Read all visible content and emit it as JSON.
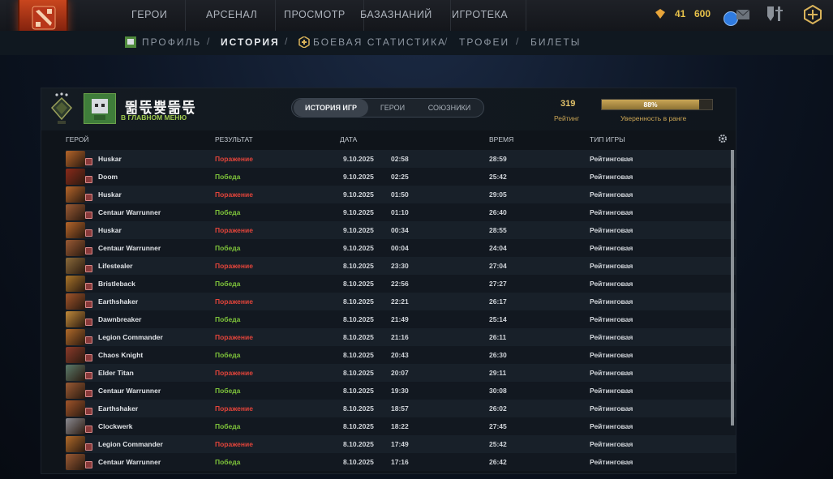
{
  "nav": {
    "items": [
      "ГЕРОИ",
      "АРСЕНАЛ",
      "ПРОСМОТР",
      "БАЗАЗНАНИЙ",
      "ИГРОТЕКА"
    ],
    "coins_a": "41",
    "coins_b": "600"
  },
  "subnav": {
    "items": [
      "ПРОФИЛЬ",
      "ИСТОРИЯ",
      "БОЕВАЯ СТАТИСТИКА",
      "ТРОФЕИ",
      "БИЛЕТЫ"
    ],
    "active": "ИСТОРИЯ",
    "separator": "/"
  },
  "player": {
    "name": "뛺뜫쁒뜲뜫",
    "status": "В ГЛАВНОМ МЕНЮ"
  },
  "tabs": [
    "ИСТОРИЯ ИГР",
    "ГЕРОИ",
    "СОЮЗНИКИ"
  ],
  "rating": {
    "value": "319",
    "label": "Рейтинг",
    "confidence": "88%",
    "confidence_fraction": 0.88,
    "confidence_label": "Уверенность в ранге"
  },
  "columns": [
    "ГЕРОЙ",
    "РЕЗУЛЬТАТ",
    "ДАТА",
    "ВРЕМЯ",
    "ТИП ИГРЫ"
  ],
  "colors": {
    "loss": "#e2443a",
    "win": "#7ec33a",
    "gold": "#e3c36a"
  },
  "matches": [
    {
      "hero": "Huskar",
      "result": "Поражение",
      "outcome": "loss",
      "date": "9.10.2025",
      "time": "02:58",
      "duration": "28:59",
      "type": "Рейтинговая"
    },
    {
      "hero": "Doom",
      "result": "Победа",
      "outcome": "win",
      "date": "9.10.2025",
      "time": "02:25",
      "duration": "25:42",
      "type": "Рейтинговая"
    },
    {
      "hero": "Huskar",
      "result": "Поражение",
      "outcome": "loss",
      "date": "9.10.2025",
      "time": "01:50",
      "duration": "29:05",
      "type": "Рейтинговая"
    },
    {
      "hero": "Centaur Warrunner",
      "result": "Победа",
      "outcome": "win",
      "date": "9.10.2025",
      "time": "01:10",
      "duration": "26:40",
      "type": "Рейтинговая"
    },
    {
      "hero": "Huskar",
      "result": "Поражение",
      "outcome": "loss",
      "date": "9.10.2025",
      "time": "00:34",
      "duration": "28:55",
      "type": "Рейтинговая"
    },
    {
      "hero": "Centaur Warrunner",
      "result": "Победа",
      "outcome": "win",
      "date": "9.10.2025",
      "time": "00:04",
      "duration": "24:04",
      "type": "Рейтинговая"
    },
    {
      "hero": "Lifestealer",
      "result": "Поражение",
      "outcome": "loss",
      "date": "8.10.2025",
      "time": "23:30",
      "duration": "27:04",
      "type": "Рейтинговая"
    },
    {
      "hero": "Bristleback",
      "result": "Победа",
      "outcome": "win",
      "date": "8.10.2025",
      "time": "22:56",
      "duration": "27:27",
      "type": "Рейтинговая"
    },
    {
      "hero": "Earthshaker",
      "result": "Поражение",
      "outcome": "loss",
      "date": "8.10.2025",
      "time": "22:21",
      "duration": "26:17",
      "type": "Рейтинговая"
    },
    {
      "hero": "Dawnbreaker",
      "result": "Победа",
      "outcome": "win",
      "date": "8.10.2025",
      "time": "21:49",
      "duration": "25:14",
      "type": "Рейтинговая"
    },
    {
      "hero": "Legion Commander",
      "result": "Поражение",
      "outcome": "loss",
      "date": "8.10.2025",
      "time": "21:16",
      "duration": "26:11",
      "type": "Рейтинговая"
    },
    {
      "hero": "Chaos Knight",
      "result": "Победа",
      "outcome": "win",
      "date": "8.10.2025",
      "time": "20:43",
      "duration": "26:30",
      "type": "Рейтинговая"
    },
    {
      "hero": "Elder Titan",
      "result": "Поражение",
      "outcome": "loss",
      "date": "8.10.2025",
      "time": "20:07",
      "duration": "29:11",
      "type": "Рейтинговая"
    },
    {
      "hero": "Centaur Warrunner",
      "result": "Победа",
      "outcome": "win",
      "date": "8.10.2025",
      "time": "19:30",
      "duration": "30:08",
      "type": "Рейтинговая"
    },
    {
      "hero": "Earthshaker",
      "result": "Поражение",
      "outcome": "loss",
      "date": "8.10.2025",
      "time": "18:57",
      "duration": "26:02",
      "type": "Рейтинговая"
    },
    {
      "hero": "Clockwerk",
      "result": "Победа",
      "outcome": "win",
      "date": "8.10.2025",
      "time": "18:22",
      "duration": "27:45",
      "type": "Рейтинговая"
    },
    {
      "hero": "Legion Commander",
      "result": "Поражение",
      "outcome": "loss",
      "date": "8.10.2025",
      "time": "17:49",
      "duration": "25:42",
      "type": "Рейтинговая"
    },
    {
      "hero": "Centaur Warrunner",
      "result": "Победа",
      "outcome": "win",
      "date": "8.10.2025",
      "time": "17:16",
      "duration": "26:42",
      "type": "Рейтинговая"
    }
  ]
}
